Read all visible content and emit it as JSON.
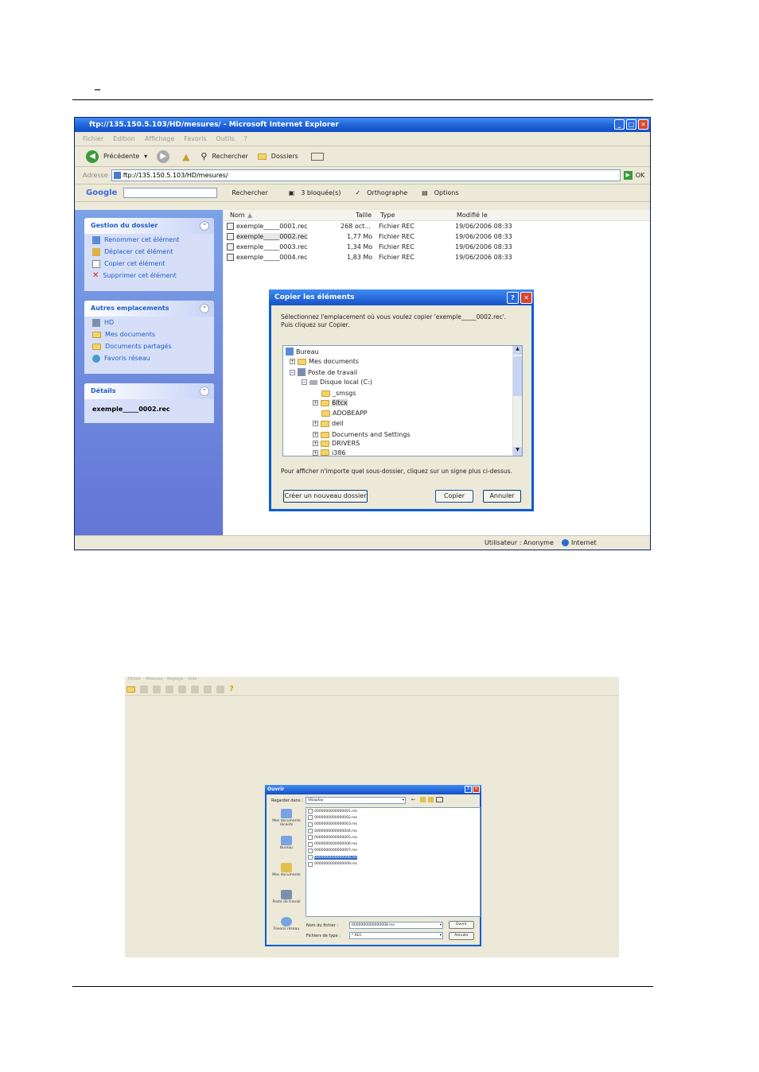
{
  "page": {
    "heading_mark": "_"
  },
  "ie": {
    "title": "ftp://135.150.5.103/HD/mesures/ - Microsoft Internet Explorer",
    "menu": [
      "Fichier",
      "Edition",
      "Affichage",
      "Favoris",
      "Outils",
      "?"
    ],
    "toolbar": {
      "back": "Précédente",
      "search": "Rechercher",
      "folders": "Dossiers"
    },
    "address": {
      "label": "Adresse",
      "value": "ftp://135.150.5.103/HD/mesures/",
      "go": "OK"
    },
    "google": {
      "logo": "Google",
      "search": "Rechercher",
      "blocked": "3 bloquée(s)",
      "spell": "Orthographe",
      "options": "Options"
    },
    "tasks": {
      "title": "Gestion du dossier",
      "items": [
        "Renommer cet élément",
        "Déplacer cet élément",
        "Copier cet élément",
        "Supprimer cet élément"
      ]
    },
    "places": {
      "title": "Autres emplacements",
      "items": [
        "HD",
        "Mes documents",
        "Documents partagés",
        "Favoris réseau"
      ]
    },
    "details": {
      "title": "Détails",
      "value": "exemple_____0002.rec"
    },
    "columns": {
      "name": "Nom",
      "size": "Taille",
      "type": "Type",
      "modified": "Modifié le"
    },
    "files": [
      {
        "name": "exemple_____0001.rec",
        "size": "268 oct...",
        "type": "Fichier REC",
        "modified": "19/06/2006 08:33"
      },
      {
        "name": "exemple_____0002.rec",
        "size": "1,77 Mo",
        "type": "Fichier REC",
        "modified": "19/06/2006 08:33"
      },
      {
        "name": "exemple_____0003.rec",
        "size": "1,34 Mo",
        "type": "Fichier REC",
        "modified": "19/06/2006 08:33"
      },
      {
        "name": "exemple_____0004.rec",
        "size": "1,83 Mo",
        "type": "Fichier REC",
        "modified": "19/06/2006 08:33"
      }
    ],
    "status": {
      "user": "Utilisateur : Anonyme",
      "zone": "Internet"
    }
  },
  "copy_dialog": {
    "title": "Copier les éléments",
    "instruction_1": "Sélectionnez l'emplacement où vous voulez copier 'exemple_____0002.rec'.",
    "instruction_2": "Puis cliquez sur Copier.",
    "tree": [
      "Bureau",
      "Mes documents",
      "Poste de travail",
      "Disque local (C:)",
      "_smsgs",
      "6ltcx",
      "ADOBEAPP",
      "dell",
      "Documents and Settings",
      "DRIVERS",
      "i386"
    ],
    "hint": "Pour afficher n'importe quel sous-dossier, cliquez sur un signe plus ci-dessus.",
    "new_folder": "Créer un nouveau dossier",
    "copy": "Copier",
    "cancel": "Annuler"
  },
  "open_dialog": {
    "title": "Ouvrir",
    "menu": [
      "Fichier",
      "Mesures",
      "Réglage",
      "Aide"
    ],
    "look_in_label": "Regarder dans :",
    "look_in_value": "Vibaplay",
    "places": [
      "Mes documents récents",
      "Bureau",
      "Mes documents",
      "Poste de travail",
      "Favoris réseau"
    ],
    "files": [
      "0000000000000001.rec",
      "0000000000000002.rec",
      "0000000000000003.rec",
      "0000000000000004.rec",
      "0000000000000005.rec",
      "0000000000000006.rec",
      "0000000000000007.rec",
      "0000000000000008.rec",
      "0000000000000009.rec"
    ],
    "selected_index": 7,
    "filename_label": "Nom du fichier :",
    "filename_value": "0000000000000008.rec",
    "filetype_label": "Fichiers de type :",
    "filetype_value": "*.REC",
    "open": "Ouvrir",
    "cancel": "Annuler"
  }
}
